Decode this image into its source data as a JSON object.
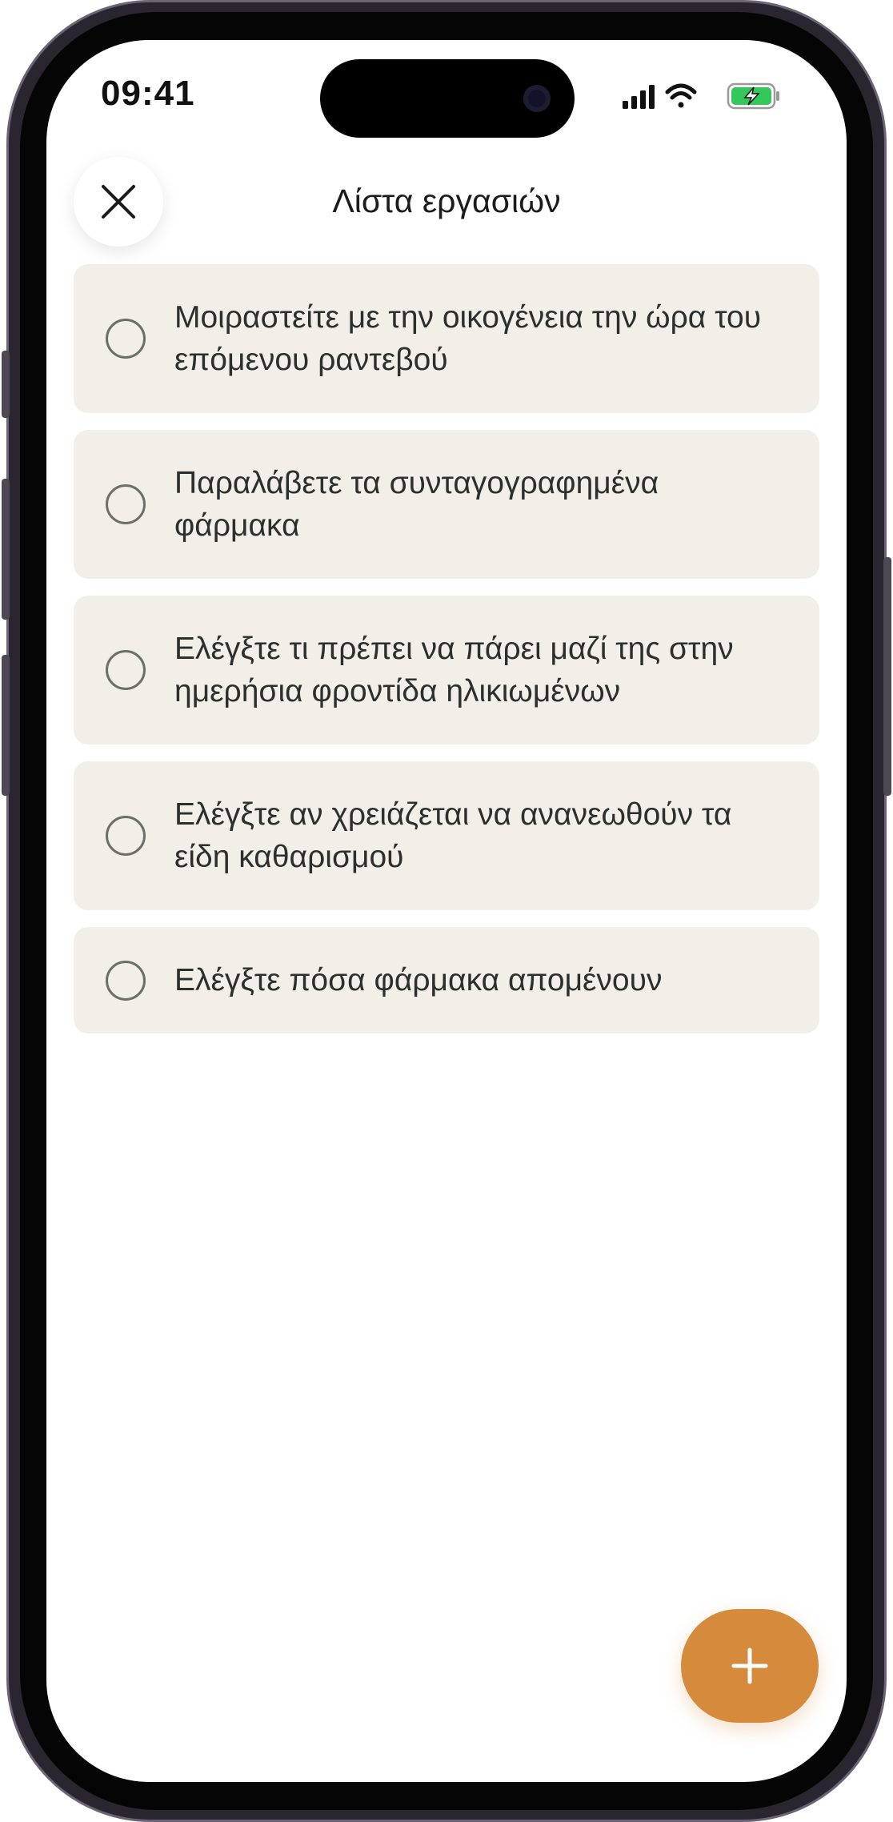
{
  "status_bar": {
    "time": "09:41",
    "icons": [
      "cellular-signal-icon",
      "wifi-icon",
      "battery-charging-icon"
    ],
    "battery_color": "#34c759"
  },
  "header": {
    "title": "Λίστα εργασιών",
    "close_icon": "close-icon"
  },
  "tasks": [
    {
      "text": "Μοιραστείτε με την οικογένεια την ώρα του επόμενου ραντεβού",
      "checked": false
    },
    {
      "text": "Παραλάβετε τα συνταγογραφημένα φάρμακα",
      "checked": false
    },
    {
      "text": "Ελέγξτε τι πρέπει να πάρει μαζί της στην ημερήσια φροντίδα ηλικιωμένων",
      "checked": false
    },
    {
      "text": "Ελέγξτε αν χρειάζεται να ανανεωθούν τα είδη καθαρισμού",
      "checked": false
    },
    {
      "text": "Ελέγξτε πόσα φάρμακα απομένουν",
      "checked": false
    }
  ],
  "fab": {
    "icon": "plus-icon",
    "color": "#d68a3b"
  },
  "colors": {
    "task_background": "#f1efe7",
    "text": "#2d2f2c",
    "accent": "#d68a3b"
  }
}
